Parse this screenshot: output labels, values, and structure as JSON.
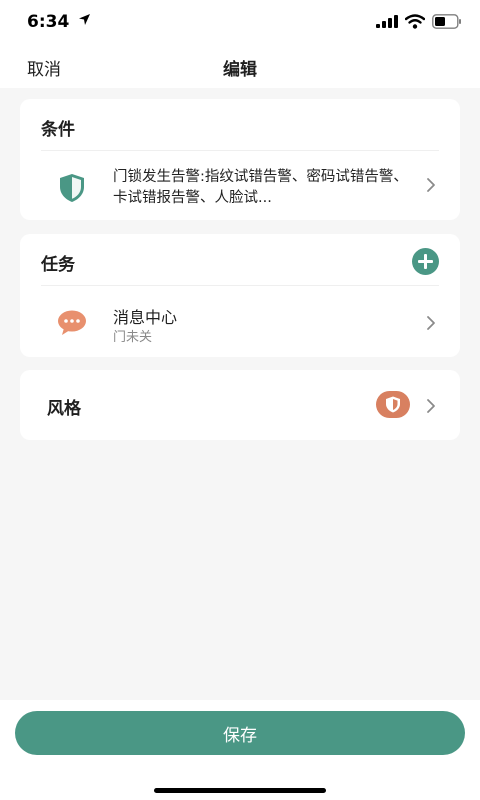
{
  "status_bar": {
    "time": "6:34",
    "icons": [
      "location-arrow-icon",
      "signal-icon",
      "wifi-icon",
      "battery-icon"
    ]
  },
  "nav": {
    "cancel_label": "取消",
    "title": "编辑"
  },
  "condition_card": {
    "header": "条件",
    "icon": "shield-icon",
    "text": "门锁发生告警:指纹试错告警、密码试错告警、卡试错报告警、人脸试..."
  },
  "task_card": {
    "header": "任务",
    "add_icon": "plus-circle-icon",
    "item": {
      "icon": "message-bubble-icon",
      "title": "消息中心",
      "subtitle": "门未关"
    }
  },
  "style_card": {
    "label": "风格",
    "badge_icon": "shield-icon"
  },
  "footer": {
    "save_label": "保存"
  },
  "colors": {
    "accent": "#4a9785",
    "orange": "#e8906e",
    "badge": "#d88060",
    "background": "#f6f6f6"
  }
}
